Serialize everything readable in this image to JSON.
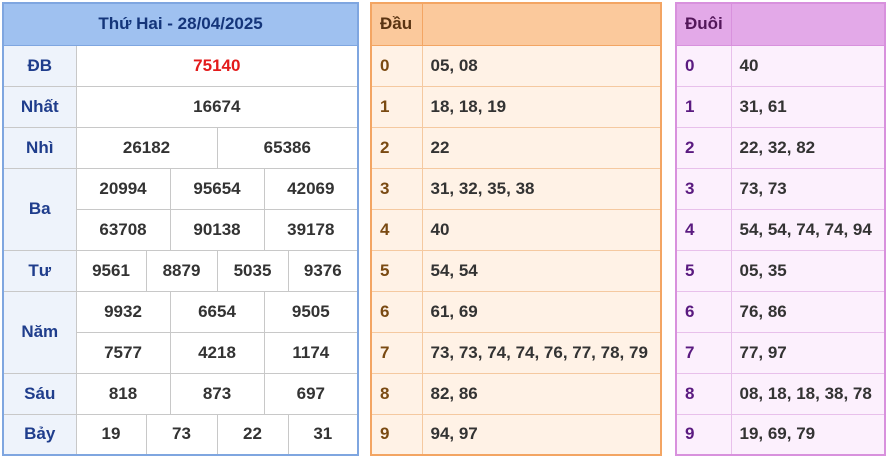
{
  "results": {
    "title": "Thứ Hai - 28/04/2025",
    "special": {
      "label": "ĐB",
      "value": "75140"
    },
    "first": {
      "label": "Nhất",
      "value": "16674"
    },
    "second": {
      "label": "Nhì",
      "values": [
        "26182",
        "65386"
      ]
    },
    "third": {
      "label": "Ba",
      "rows": [
        [
          "20994",
          "95654",
          "42069"
        ],
        [
          "63708",
          "90138",
          "39178"
        ]
      ]
    },
    "fourth": {
      "label": "Tư",
      "values": [
        "9561",
        "8879",
        "5035",
        "9376"
      ]
    },
    "fifth": {
      "label": "Năm",
      "rows": [
        [
          "9932",
          "6654",
          "9505"
        ],
        [
          "7577",
          "4218",
          "1174"
        ]
      ]
    },
    "sixth": {
      "label": "Sáu",
      "values": [
        "818",
        "873",
        "697"
      ]
    },
    "seventh": {
      "label": "Bảy",
      "values": [
        "19",
        "73",
        "22",
        "31"
      ]
    }
  },
  "head": {
    "title": "Đầu",
    "rows": [
      {
        "digit": "0",
        "numbers": "05, 08"
      },
      {
        "digit": "1",
        "numbers": "18, 18, 19"
      },
      {
        "digit": "2",
        "numbers": "22"
      },
      {
        "digit": "3",
        "numbers": "31, 32, 35, 38"
      },
      {
        "digit": "4",
        "numbers": "40"
      },
      {
        "digit": "5",
        "numbers": "54, 54"
      },
      {
        "digit": "6",
        "numbers": "61, 69"
      },
      {
        "digit": "7",
        "numbers": "73, 73, 74, 74, 76, 77, 78, 79"
      },
      {
        "digit": "8",
        "numbers": "82, 86"
      },
      {
        "digit": "9",
        "numbers": "94, 97"
      }
    ]
  },
  "tail": {
    "title": "Đuôi",
    "rows": [
      {
        "digit": "0",
        "numbers": "40"
      },
      {
        "digit": "1",
        "numbers": "31, 61"
      },
      {
        "digit": "2",
        "numbers": "22, 32, 82"
      },
      {
        "digit": "3",
        "numbers": "73, 73"
      },
      {
        "digit": "4",
        "numbers": "54, 54, 74, 74, 94"
      },
      {
        "digit": "5",
        "numbers": "05, 35"
      },
      {
        "digit": "6",
        "numbers": "76, 86"
      },
      {
        "digit": "7",
        "numbers": "77, 97"
      },
      {
        "digit": "8",
        "numbers": "08, 18, 18, 38, 78"
      },
      {
        "digit": "9",
        "numbers": "19, 69, 79"
      }
    ]
  },
  "colors": {
    "results_header": "#9fc1f0",
    "head_header": "#fbc99c",
    "tail_header": "#e3a9e8",
    "special_value": "#e31b1b"
  }
}
